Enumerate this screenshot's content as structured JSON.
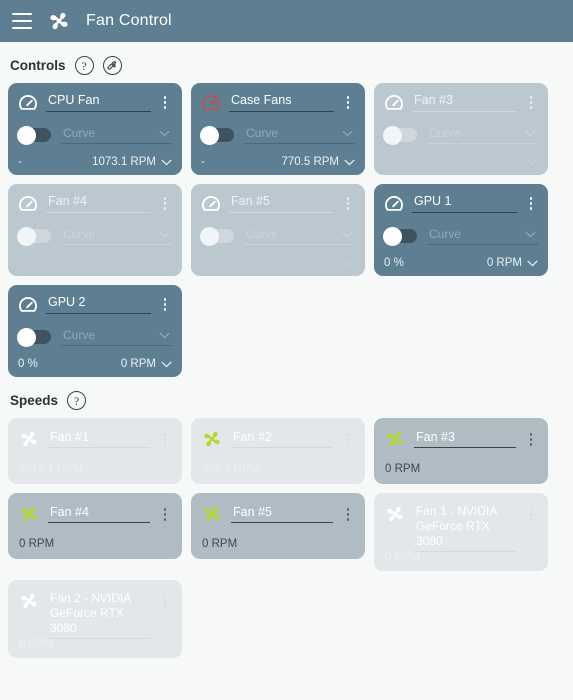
{
  "header": {
    "menu_icon": "hamburger-icon",
    "app_icon": "fan-icon",
    "title": "Fan Control"
  },
  "colors": {
    "header_bg": "#5d7f91",
    "card_active_bg": "#5d7f91",
    "card_inactive_bg": "#bcc8d0",
    "speed_light_bg": "#e3e7ea",
    "speed_dark_bg": "#b0bcc4",
    "gauge_white": "#ffffff",
    "gauge_red": "#c0504d",
    "blade_white": "#ffffff",
    "blade_green": "#b5d92c",
    "page_bg": "#f7f8f8"
  },
  "sections": {
    "controls": {
      "title": "Controls",
      "help_label": "?",
      "settings_icon": "wrench-icon"
    },
    "speeds": {
      "title": "Speeds",
      "help_label": "?"
    }
  },
  "common": {
    "curve_label": "Curve",
    "empty_value": "-",
    "menu_icon": "kebab-menu-icon",
    "dropdown_icon": "chevron-down-icon",
    "expand_icon": "chevron-down-icon",
    "toggle_state": "off"
  },
  "controls": [
    {
      "name": "CPU Fan",
      "state": "active",
      "gauge_color": "white",
      "mode": "Curve",
      "percent": "-",
      "rpm": "1073.1 RPM"
    },
    {
      "name": "Case Fans",
      "state": "active",
      "gauge_color": "red",
      "mode": "Curve",
      "percent": "-",
      "rpm": "770.5 RPM"
    },
    {
      "name": "Fan #3",
      "state": "inactive",
      "gauge_color": "white",
      "mode": "Curve",
      "percent": "-",
      "rpm": ""
    },
    {
      "name": "Fan #4",
      "state": "inactive",
      "gauge_color": "white",
      "mode": "Curve",
      "percent": "-",
      "rpm": ""
    },
    {
      "name": "Fan #5",
      "state": "inactive",
      "gauge_color": "white",
      "mode": "Curve",
      "percent": "-",
      "rpm": ""
    },
    {
      "name": "GPU 1",
      "state": "active",
      "gauge_color": "white",
      "mode": "Curve",
      "percent": "0 %",
      "rpm": "0 RPM"
    },
    {
      "name": "GPU 2",
      "state": "active",
      "gauge_color": "white",
      "mode": "Curve",
      "percent": "0 %",
      "rpm": "0 RPM"
    }
  ],
  "speeds": [
    {
      "name": "Fan #1",
      "style": "light",
      "blade_color": "white",
      "rpm": "1073.1 RPM",
      "tall": false
    },
    {
      "name": "Fan #2",
      "style": "light",
      "blade_color": "green",
      "rpm": "770.5 RPM",
      "tall": false
    },
    {
      "name": "Fan #3",
      "style": "dark",
      "blade_color": "green",
      "rpm": "0 RPM",
      "tall": false
    },
    {
      "name": "Fan #4",
      "style": "dark",
      "blade_color": "green",
      "rpm": "0 RPM",
      "tall": false
    },
    {
      "name": "Fan #5",
      "style": "dark",
      "blade_color": "green",
      "rpm": "0 RPM",
      "tall": false
    },
    {
      "name": "Fan 1 - NVIDIA GeForce RTX 3080",
      "style": "light",
      "blade_color": "white",
      "rpm": "0 RPM",
      "tall": true
    },
    {
      "name": "Fan 2 - NVIDIA GeForce RTX 3080",
      "style": "light",
      "blade_color": "white",
      "rpm": "0 RPM",
      "tall": true
    }
  ]
}
